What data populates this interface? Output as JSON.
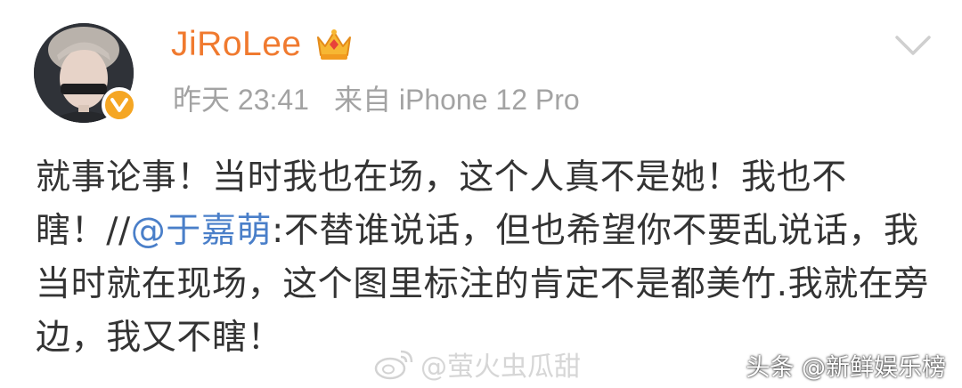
{
  "header": {
    "username": "JiRoLee",
    "timestamp": "昨天 23:41",
    "source": "来自 iPhone 12 Pro",
    "vip_icon": "crown-vip-icon",
    "menu_icon": "chevron-down-icon"
  },
  "avatar": {
    "badge_icon": "verified-v-icon",
    "badge_color": "#f5a623"
  },
  "post": {
    "text_part1": "就事论事！当时我也在场，这个人真不是她！我也不瞎！//",
    "mention": "@于嘉萌",
    "text_part2": ":不替谁说话，但也希望你不要乱说话，我当时就在现场，这个图里标注的肯定不是都美竹.我就在旁边，我又不瞎！"
  },
  "watermarks": {
    "weibo": "@萤火虫瓜甜",
    "toutiao": "头条 @新鲜娱乐榜"
  },
  "colors": {
    "username": "#f07a2f",
    "mention": "#4a7fc9",
    "text": "#333333",
    "meta": "#a3a3a3"
  }
}
